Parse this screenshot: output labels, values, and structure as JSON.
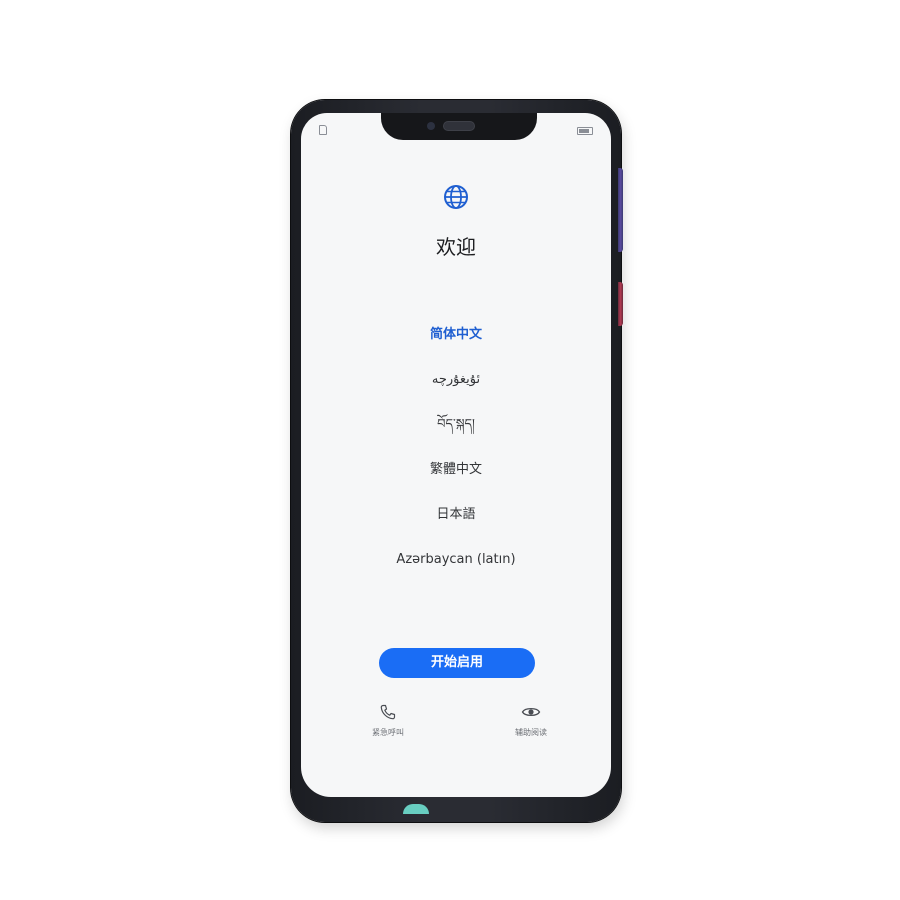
{
  "welcome": {
    "title": "欢迎",
    "globe_icon": "globe-icon"
  },
  "languages": [
    {
      "label": "简体中文",
      "selected": true
    },
    {
      "label": "ئۇيغۇرچە",
      "selected": false
    },
    {
      "label": "བོད་སྐད།",
      "selected": false
    },
    {
      "label": "繁體中文",
      "selected": false
    },
    {
      "label": "日本語",
      "selected": false
    },
    {
      "label": "Azərbaycan (latın)",
      "selected": false
    }
  ],
  "start_button": {
    "label": "开始启用"
  },
  "bottom": {
    "emergency_call": {
      "label": "紧急呼叫",
      "icon": "phone-icon"
    },
    "accessibility": {
      "label": "辅助阅读",
      "icon": "eye-icon"
    }
  },
  "colors": {
    "accent": "#1a6df5",
    "selected_text": "#1f5fd1",
    "screen_bg": "#f6f7f8"
  }
}
